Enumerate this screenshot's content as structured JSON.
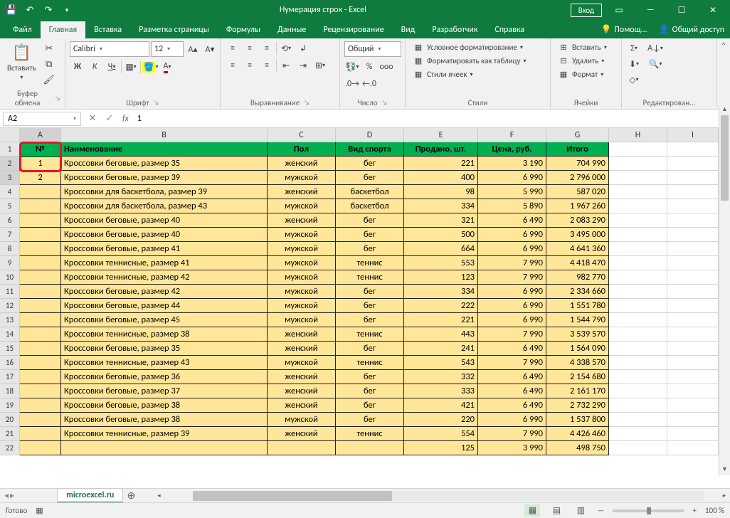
{
  "title": "Нумерация строк  -  Excel",
  "qat": {
    "save": "save-icon",
    "undo": "↶",
    "redo": "↷"
  },
  "login_button": "Вход",
  "tabs": [
    "Файл",
    "Главная",
    "Вставка",
    "Разметка страницы",
    "Формулы",
    "Данные",
    "Рецензирование",
    "Вид",
    "Разработчик",
    "Справка"
  ],
  "active_tab": "Главная",
  "tell_me": "Помощ...",
  "share": "Общий доступ",
  "ribbon": {
    "clipboard": {
      "paste": "Вставить",
      "label": "Буфер обмена"
    },
    "font": {
      "name": "Calibri",
      "size": "12",
      "label": "Шрифт"
    },
    "alignment": {
      "label": "Выравнивание"
    },
    "number": {
      "format": "Общий",
      "label": "Число"
    },
    "styles": {
      "cond": "Условное форматирование",
      "table": "Форматировать как таблицу",
      "cell": "Стили ячеек",
      "label": "Стили"
    },
    "cells": {
      "insert": "Вставить",
      "delete": "Удалить",
      "format": "Формат",
      "label": "Ячейки"
    },
    "editing": {
      "label": "Редактирован..."
    }
  },
  "namebox": "A2",
  "formula_value": "1",
  "columns": [
    "A",
    "B",
    "C",
    "D",
    "E",
    "F",
    "G",
    "H",
    "I"
  ],
  "headers": {
    "A": "№",
    "B": "Наименование",
    "C": "Пол",
    "D": "Вид спорта",
    "E": "Продано, шт.",
    "F": "Цена, руб.",
    "G": "Итого"
  },
  "rows": [
    {
      "n": "1",
      "b": "Кроссовки беговые, размер 35",
      "c": "женский",
      "d": "бег",
      "e": "221",
      "f": "3 190",
      "g": "704 990"
    },
    {
      "n": "2",
      "b": "Кроссовки беговые, размер 39",
      "c": "мужской",
      "d": "бег",
      "e": "400",
      "f": "6 990",
      "g": "2 796 000"
    },
    {
      "n": "",
      "b": "Кроссовки для баскетбола, размер 39",
      "c": "женский",
      "d": "баскетбол",
      "e": "98",
      "f": "5 990",
      "g": "587 020"
    },
    {
      "n": "",
      "b": "Кроссовки для баскетбола, размер 43",
      "c": "мужской",
      "d": "баскетбол",
      "e": "334",
      "f": "5 890",
      "g": "1 967 260"
    },
    {
      "n": "",
      "b": "Кроссовки беговые, размер 40",
      "c": "женский",
      "d": "бег",
      "e": "321",
      "f": "6 490",
      "g": "2 083 290"
    },
    {
      "n": "",
      "b": "Кроссовки беговые, размер 40",
      "c": "мужской",
      "d": "бег",
      "e": "500",
      "f": "6 990",
      "g": "3 495 000"
    },
    {
      "n": "",
      "b": "Кроссовки беговые, размер 41",
      "c": "мужской",
      "d": "бег",
      "e": "664",
      "f": "6 990",
      "g": "4 641 360"
    },
    {
      "n": "",
      "b": "Кроссовки теннисные, размер 41",
      "c": "мужской",
      "d": "теннис",
      "e": "553",
      "f": "7 990",
      "g": "4 418 470"
    },
    {
      "n": "",
      "b": "Кроссовки теннисные, размер 42",
      "c": "мужской",
      "d": "теннис",
      "e": "123",
      "f": "7 990",
      "g": "982 770"
    },
    {
      "n": "",
      "b": "Кроссовки беговые, размер 42",
      "c": "мужской",
      "d": "бег",
      "e": "334",
      "f": "6 990",
      "g": "2 334 660"
    },
    {
      "n": "",
      "b": "Кроссовки беговые, размер 44",
      "c": "мужской",
      "d": "бег",
      "e": "222",
      "f": "6 990",
      "g": "1 551 780"
    },
    {
      "n": "",
      "b": "Кроссовки беговые, размер 45",
      "c": "мужской",
      "d": "бег",
      "e": "221",
      "f": "6 990",
      "g": "1 544 790"
    },
    {
      "n": "",
      "b": "Кроссовки теннисные, размер 38",
      "c": "женский",
      "d": "теннис",
      "e": "443",
      "f": "7 990",
      "g": "3 539 570"
    },
    {
      "n": "",
      "b": "Кроссовки беговые, размер 35",
      "c": "женский",
      "d": "бег",
      "e": "241",
      "f": "6 490",
      "g": "1 564 090"
    },
    {
      "n": "",
      "b": "Кроссовки теннисные, размер 43",
      "c": "мужской",
      "d": "теннис",
      "e": "543",
      "f": "7 990",
      "g": "4 338 570"
    },
    {
      "n": "",
      "b": "Кроссовки беговые, размер 36",
      "c": "женский",
      "d": "бег",
      "e": "332",
      "f": "6 490",
      "g": "2 154 680"
    },
    {
      "n": "",
      "b": "Кроссовки беговые, размер 37",
      "c": "женский",
      "d": "бег",
      "e": "333",
      "f": "6 490",
      "g": "2 161 170"
    },
    {
      "n": "",
      "b": "Кроссовки беговые, размер 38",
      "c": "женский",
      "d": "бег",
      "e": "421",
      "f": "6 490",
      "g": "2 732 290"
    },
    {
      "n": "",
      "b": "Кроссовки беговые, размер 38",
      "c": "мужской",
      "d": "бег",
      "e": "220",
      "f": "6 990",
      "g": "1 537 800"
    },
    {
      "n": "",
      "b": "Кроссовки теннисные, размер 39",
      "c": "женский",
      "d": "теннис",
      "e": "554",
      "f": "7 990",
      "g": "4 426 460"
    },
    {
      "n": "",
      "b": "",
      "c": "",
      "d": "",
      "e": "125",
      "f": "3 990",
      "g": "498 750"
    }
  ],
  "sheet_tab": "microexcel.ru",
  "status": {
    "ready": "Готово",
    "zoom": "100 %"
  }
}
